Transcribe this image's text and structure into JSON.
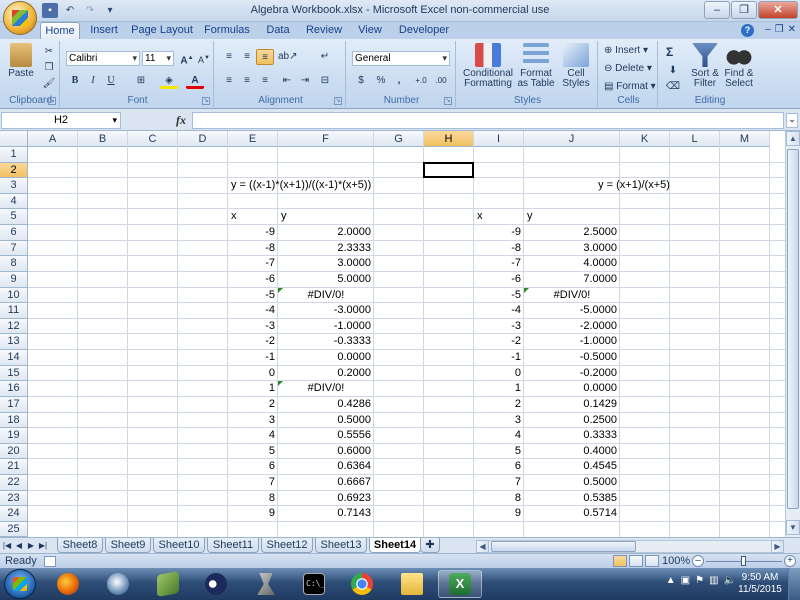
{
  "window": {
    "title": "Algebra Workbook.xlsx - Microsoft Excel non-commercial use"
  },
  "ribbon_tabs": [
    "Home",
    "Insert",
    "Page Layout",
    "Formulas",
    "Data",
    "Review",
    "View",
    "Developer"
  ],
  "ribbon": {
    "clipboard": {
      "label": "Clipboard",
      "paste": "Paste"
    },
    "font": {
      "label": "Font",
      "name": "Calibri",
      "size": "11",
      "bold": "B",
      "italic": "I",
      "underline": "U"
    },
    "alignment": {
      "label": "Alignment"
    },
    "number": {
      "label": "Number",
      "format": "General",
      "currency": "$",
      "percent": "%",
      "comma": ",",
      "inc": "+.0",
      "dec": ".00"
    },
    "styles": {
      "label": "Styles",
      "conditional": "Conditional",
      "conditional2": "Formatting",
      "format_table": "Format",
      "format_table2": "as Table",
      "cell_styles": "Cell",
      "cell_styles2": "Styles"
    },
    "cells": {
      "label": "Cells",
      "insert": "Insert",
      "delete": "Delete",
      "format": "Format"
    },
    "editing": {
      "label": "Editing",
      "sigma": "Σ",
      "sort": "Sort &",
      "sort2": "Filter",
      "find": "Find &",
      "find2": "Select"
    }
  },
  "formula_bar": {
    "name_box": "H2",
    "fx": "fx",
    "value": ""
  },
  "columns": [
    "A",
    "B",
    "C",
    "D",
    "E",
    "F",
    "G",
    "H",
    "I",
    "J",
    "K",
    "L",
    "M"
  ],
  "rows": [
    "1",
    "2",
    "3",
    "4",
    "5",
    "6",
    "7",
    "8",
    "9",
    "10",
    "11",
    "12",
    "13",
    "14",
    "15",
    "16",
    "17",
    "18",
    "19",
    "20",
    "21",
    "22",
    "23",
    "24",
    "25"
  ],
  "cells": {
    "E3": "y = ((x-1)*(x+1))/((x-1)*(x+5))",
    "J3": "y = (x+1)/(x+5)",
    "E5": "x",
    "F5": "y",
    "I5": "x",
    "J5": "y",
    "left_x": [
      "-9",
      "-8",
      "-7",
      "-6",
      "-5",
      "-4",
      "-3",
      "-2",
      "-1",
      "0",
      "1",
      "2",
      "3",
      "4",
      "5",
      "6",
      "7",
      "8",
      "9"
    ],
    "left_y": [
      "2.0000",
      "2.3333",
      "3.0000",
      "5.0000",
      "#DIV/0!",
      "-3.0000",
      "-1.0000",
      "-0.3333",
      "0.0000",
      "0.2000",
      "#DIV/0!",
      "0.4286",
      "0.5000",
      "0.5556",
      "0.6000",
      "0.6364",
      "0.6667",
      "0.6923",
      "0.7143"
    ],
    "right_x": [
      "-9",
      "-8",
      "-7",
      "-6",
      "-5",
      "-4",
      "-3",
      "-2",
      "-1",
      "0",
      "1",
      "2",
      "3",
      "4",
      "5",
      "6",
      "7",
      "8",
      "9"
    ],
    "right_y": [
      "2.5000",
      "3.0000",
      "4.0000",
      "7.0000",
      "#DIV/0!",
      "-5.0000",
      "-2.0000",
      "-1.0000",
      "-0.5000",
      "-0.2000",
      "0.0000",
      "0.1429",
      "0.2500",
      "0.3333",
      "0.4000",
      "0.4545",
      "0.5000",
      "0.5385",
      "0.5714"
    ]
  },
  "sheets": [
    "Sheet8",
    "Sheet9",
    "Sheet10",
    "Sheet11",
    "Sheet12",
    "Sheet13",
    "Sheet14"
  ],
  "active_sheet": "Sheet14",
  "status": {
    "ready": "Ready",
    "zoom": "100%"
  },
  "clock": {
    "time": "9:50 AM",
    "date": "11/5/2015"
  }
}
